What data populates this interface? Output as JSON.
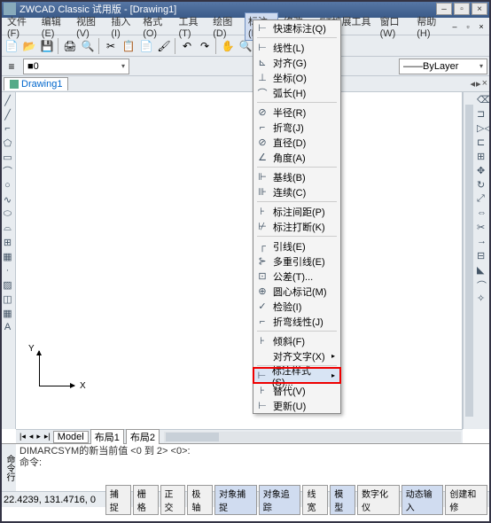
{
  "title": "ZWCAD Classic 试用版 - [Drawing1]",
  "menubar": [
    "文件(F)",
    "编辑(E)",
    "视图(V)",
    "插入(I)",
    "格式(O)",
    "工具(T)",
    "绘图(D)",
    "标注(N)",
    "修改(M)",
    "ET扩展工具(X)",
    "窗口(W)",
    "帮助(H)"
  ],
  "active_menu_index": 7,
  "propbar": {
    "layer_color": "■",
    "layer_name": "0",
    "bylayer": "ByLayer"
  },
  "doctab": "Drawing1",
  "ucs": {
    "x": "X",
    "y": "Y"
  },
  "layout": {
    "model": "Model",
    "tab1": "布局1",
    "tab2": "布局2"
  },
  "cmd": {
    "label": "命令行",
    "line1": "DIMARCSYM的新当前值 <0 到 2> <0>:",
    "prompt": "命令:"
  },
  "status": {
    "coord": "22.4239, 131.4716, 0",
    "btns": [
      "捕捉",
      "栅格",
      "正交",
      "极轴",
      "对象捕捉",
      "对象追踪",
      "线宽",
      "模型",
      "数字化仪",
      "动态输入"
    ],
    "last": "创建和修"
  },
  "dropdown": [
    {
      "ico": "⊢",
      "label": "快速标注(Q)"
    },
    {
      "sep": true
    },
    {
      "ico": "⊢",
      "label": "线性(L)"
    },
    {
      "ico": "⊾",
      "label": "对齐(G)"
    },
    {
      "ico": "⊥",
      "label": "坐标(O)"
    },
    {
      "ico": "⌒",
      "label": "弧长(H)"
    },
    {
      "sep": true
    },
    {
      "ico": "⊘",
      "label": "半径(R)"
    },
    {
      "ico": "⌐",
      "label": "折弯(J)"
    },
    {
      "ico": "⊘",
      "label": "直径(D)"
    },
    {
      "ico": "∠",
      "label": "角度(A)"
    },
    {
      "sep": true
    },
    {
      "ico": "⊩",
      "label": "基线(B)"
    },
    {
      "ico": "⊪",
      "label": "连续(C)"
    },
    {
      "sep": true
    },
    {
      "ico": "⊦",
      "label": "标注间距(P)"
    },
    {
      "ico": "⊬",
      "label": "标注打断(K)"
    },
    {
      "sep": true
    },
    {
      "ico": "┌",
      "label": "引线(E)"
    },
    {
      "ico": "⊱",
      "label": "多重引线(E)"
    },
    {
      "ico": "⊡",
      "label": "公差(T)...",
      "arrow": false
    },
    {
      "ico": "⊕",
      "label": "圆心标记(M)"
    },
    {
      "ico": "✓",
      "label": "检验(I)"
    },
    {
      "ico": "⌐",
      "label": "折弯线性(J)"
    },
    {
      "sep": true
    },
    {
      "ico": "⊦",
      "label": "倾斜(F)"
    },
    {
      "ico": "",
      "label": "对齐文字(X)",
      "arrow": true
    },
    {
      "sep": true
    },
    {
      "ico": "⊢",
      "label": "标注样式(S)...",
      "hl": true,
      "arrow": true
    },
    {
      "ico": "⊦",
      "label": "替代(V)"
    },
    {
      "ico": "⊢",
      "label": "更新(U)"
    }
  ]
}
